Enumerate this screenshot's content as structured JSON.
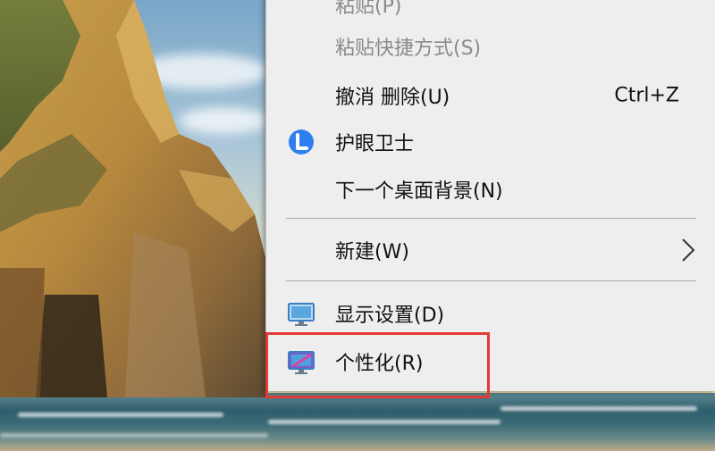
{
  "context_menu": {
    "items": [
      {
        "label": "粘贴(P)",
        "state": "disabled"
      },
      {
        "label": "粘贴快捷方式(S)",
        "state": "disabled"
      },
      {
        "label": "撤消 删除(U)",
        "shortcut": "Ctrl+Z"
      },
      {
        "label": "护眼卫士",
        "icon": "eye-guard-icon"
      },
      {
        "label": "下一个桌面背景(N)"
      },
      {
        "label": "新建(W)",
        "submenu_icon": "chevron-right-icon"
      },
      {
        "label": "显示设置(D)",
        "icon": "display-settings-icon"
      },
      {
        "label": "个性化(R)",
        "icon": "personalize-icon"
      }
    ]
  },
  "annotation": {
    "highlight_color": "#e53935",
    "target": "个性化(R)"
  },
  "colors": {
    "menu_bg": "#eeeeee",
    "disabled_text": "#8a8a8a",
    "eye_guard_blue": "#2f7ff0"
  }
}
